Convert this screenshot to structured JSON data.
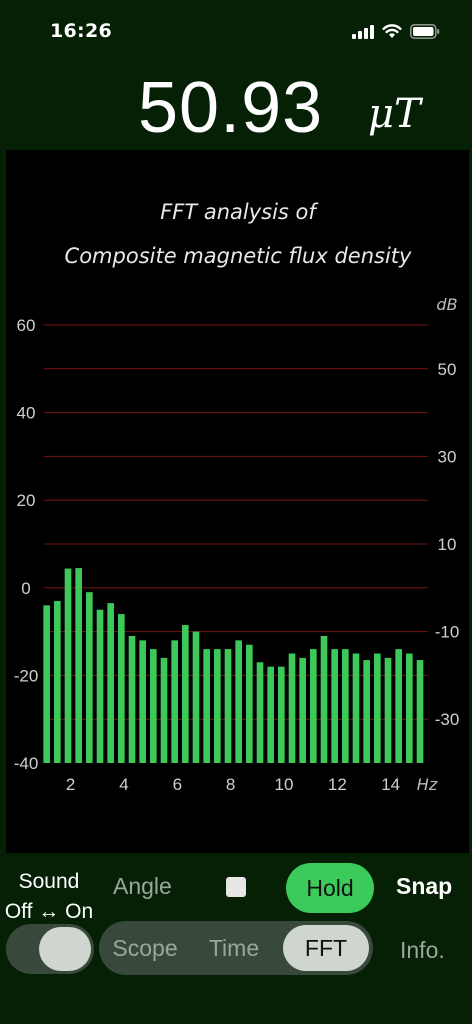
{
  "status_bar": {
    "time": "16:26"
  },
  "reading": {
    "value": "50.93",
    "unit": "μT"
  },
  "chart_data": {
    "type": "bar",
    "title": [
      "FFT analysis of",
      "Composite magnetic flux density"
    ],
    "ylabel_right": "dB",
    "xlabel": "Hz",
    "ylim_left": [
      -40,
      60
    ],
    "ylim_right": [
      -40,
      60
    ],
    "left_ticks": [
      60,
      40,
      20,
      0,
      -20,
      -40
    ],
    "right_ticks": [
      50,
      30,
      10,
      -10,
      -30
    ],
    "x_ticks": [
      2,
      4,
      6,
      8,
      10,
      12,
      14
    ],
    "xlim": [
      1,
      15.4
    ],
    "grid": true,
    "bar_color": "#3dc95a",
    "grid_color": "#7a1414",
    "x": [
      1.1,
      1.5,
      1.9,
      2.3,
      2.7,
      3.1,
      3.5,
      3.9,
      4.3,
      4.7,
      5.1,
      5.5,
      5.9,
      6.3,
      6.7,
      7.1,
      7.5,
      7.9,
      8.3,
      8.7,
      9.1,
      9.5,
      9.9,
      10.3,
      10.7,
      11.1,
      11.5,
      11.9,
      12.3,
      12.7,
      13.1,
      13.5,
      13.9,
      14.3,
      14.7,
      15.1
    ],
    "values": [
      -4,
      -3,
      4.4,
      4.5,
      -1,
      -5,
      -3.5,
      -6,
      -11,
      -12,
      -14,
      -16,
      -12,
      -8.5,
      -10,
      -14,
      -14,
      -14,
      -12,
      -13,
      -17,
      -18,
      -18,
      -15,
      -16,
      -14,
      -11,
      -14,
      -14,
      -15,
      -16.5,
      -15,
      -16,
      -14,
      -15,
      -16.5
    ]
  },
  "controls": {
    "sound_label_1": "Sound",
    "sound_label_2": "Off ↔ On",
    "angle": "Angle",
    "hold": "Hold",
    "snap": "Snap",
    "tabs": {
      "scope": "Scope",
      "time": "Time",
      "fft": "FFT"
    },
    "info": "Info."
  }
}
